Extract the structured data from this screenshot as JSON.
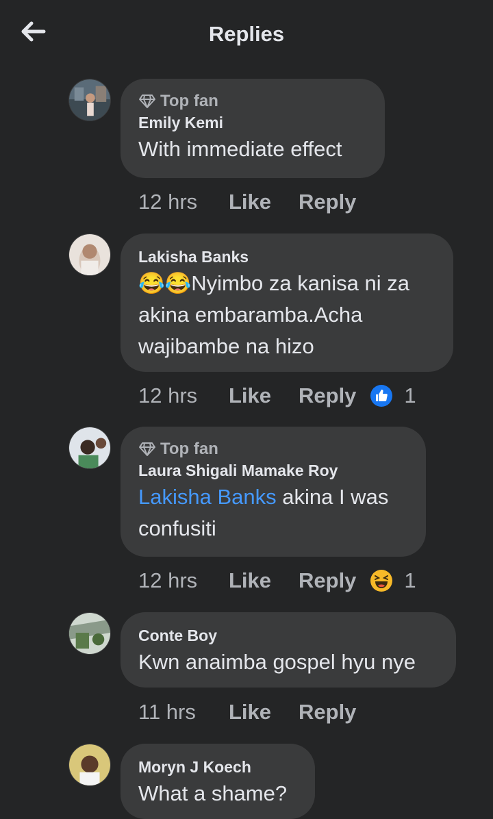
{
  "header": {
    "title": "Replies",
    "back_icon": "arrow-left-icon"
  },
  "comments": [
    {
      "author": "Emily Kemi",
      "badge": "Top fan",
      "text": "With immediate effect",
      "time": "12 hrs",
      "like_label": "Like",
      "reply_label": "Reply"
    },
    {
      "author": "Lakisha Banks",
      "text_emoji": "😂😂",
      "text_line1": "Nyimbo za kanisa ni za",
      "text_line2": "akina embaramba.Acha",
      "text_line3": "wajibambe na hizo",
      "time": "12 hrs",
      "like_label": "Like",
      "reply_label": "Reply",
      "reaction": {
        "icon": "thumbs-up-icon",
        "count": "1"
      }
    },
    {
      "author": "Laura Shigali Mamake Roy",
      "badge": "Top fan",
      "mention": "Lakisha Banks",
      "text_rest": " akina I was",
      "text_line2": "confusiti",
      "time": "12 hrs",
      "like_label": "Like",
      "reply_label": "Reply",
      "reaction": {
        "icon": "haha-icon",
        "count": "1"
      }
    },
    {
      "author": "Conte Boy",
      "text": "Kwn anaimba gospel hyu nye",
      "time": "11 hrs",
      "like_label": "Like",
      "reply_label": "Reply"
    },
    {
      "author": "Moryn J Koech",
      "text": "What a shame?"
    }
  ],
  "colors": {
    "background": "#242526",
    "bubble": "#3a3b3c",
    "text_primary": "#e4e6eb",
    "text_secondary": "#b0b3b8",
    "mention": "#4599ff",
    "like_blue": "#1877f2",
    "haha_yellow": "#f7b928"
  }
}
